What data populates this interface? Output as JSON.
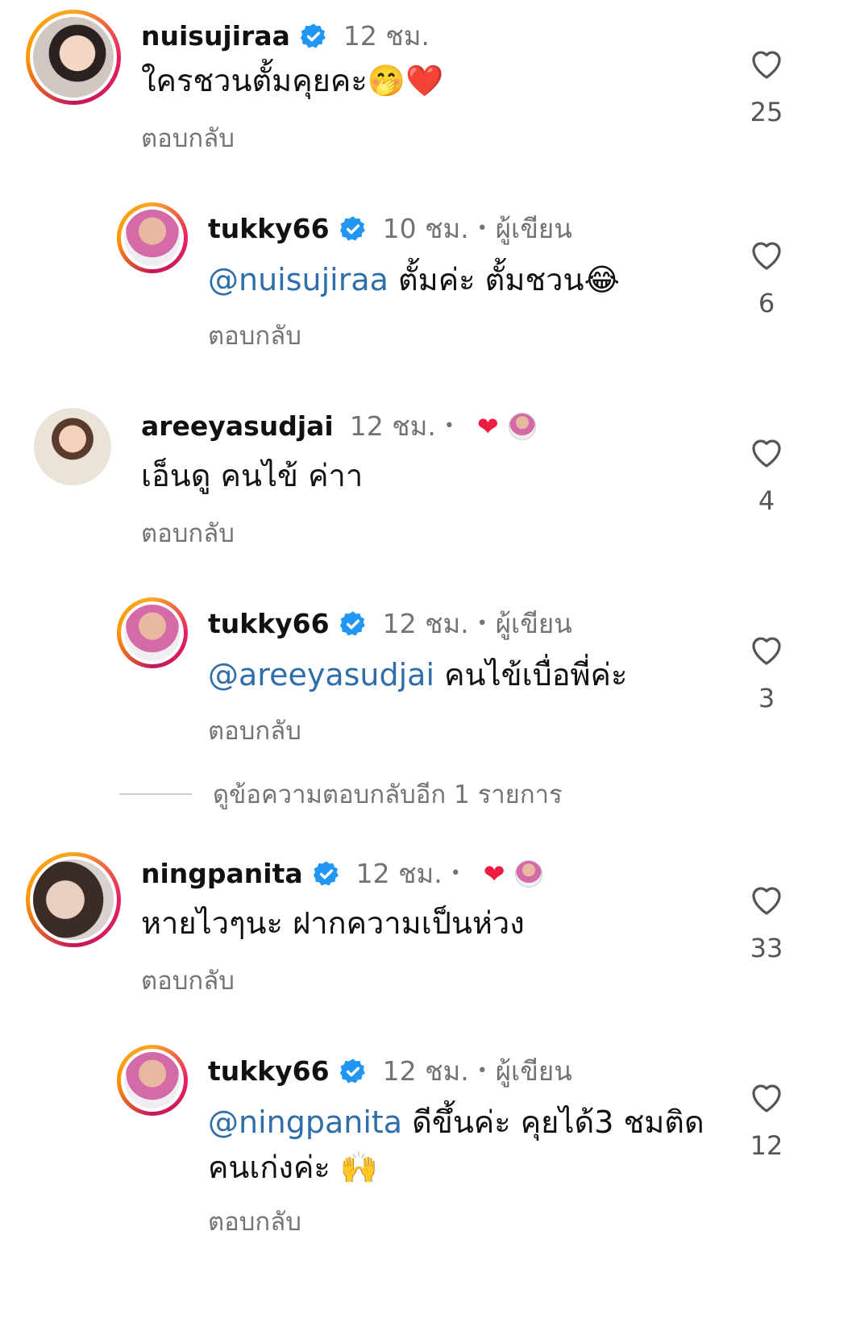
{
  "reply_label": "ตอบกลับ",
  "author_label": "ผู้เขียน",
  "view_more": "ดูข้อความตอบกลับอีก 1 รายการ",
  "comments": [
    {
      "username": "nuisujiraa",
      "time": "12 ชม.",
      "text": "ใครชวนตั้มคุยคะ🤭❤️",
      "likes": "25"
    },
    {
      "username": "tukky66",
      "time": "10 ชม.",
      "mention": "@nuisujiraa",
      "text": " ตั้มค่ะ ตั้มชวน😂",
      "likes": "6"
    },
    {
      "username": "areeyasudjai",
      "time": "12 ชม.",
      "text": "เอ็นดู คนไข้ ค่าา",
      "likes": "4"
    },
    {
      "username": "tukky66",
      "time": "12 ชม.",
      "mention": "@areeyasudjai",
      "text": " คนไข้เบื่อพี่ค่ะ",
      "likes": "3"
    },
    {
      "username": "ningpanita",
      "time": "12 ชม.",
      "text": "หายไวๆนะ ฝากความเป็นห่วง",
      "likes": "33"
    },
    {
      "username": "tukky66",
      "time": "12 ชม.",
      "mention": "@ningpanita",
      "text": " ดีขึ้นค่ะ คุยได้3 ชมติด",
      "text2": "คนเก่งค่ะ 🙌",
      "likes": "12"
    }
  ],
  "colors": {
    "mention": "#2f6ea8",
    "muted": "#737373",
    "verified": "#2196f3",
    "liked": "#ed1c40"
  }
}
